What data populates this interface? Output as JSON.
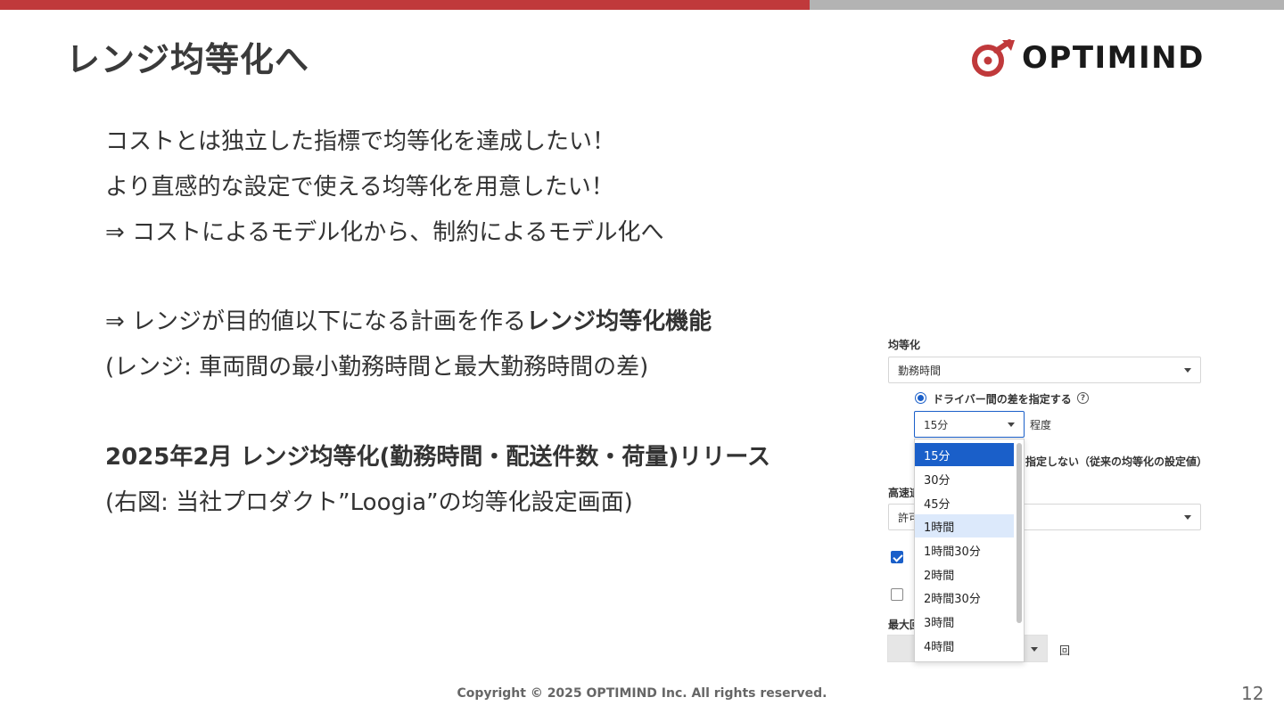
{
  "slide": {
    "title": "レンジ均等化へ",
    "logo_text": "OPTIMIND",
    "lines": [
      "コストとは独立した指標で均等化を達成したい！",
      "より直感的な設定で使える均等化を用意したい！",
      "⇒ コストによるモデル化から、制約によるモデル化へ"
    ],
    "feature_line_prefix": "⇒ レンジが目的値以下になる計画を作る",
    "feature_line_bold": "レンジ均等化機能",
    "range_def": "(レンジ: 車両間の最小勤務時間と最大勤務時間の差)",
    "release_line": "2025年2月 レンジ均等化(勤務時間・配送件数・荷量)リリース",
    "figure_caption": "(右図: 当社プロダクト”Loogia”の均等化設定画面)"
  },
  "settings_panel": {
    "section_label": "均等化",
    "metric_select_value": "勤務時間",
    "radio_option_label": "ドライバー間の差を指定する",
    "help_icon": "?",
    "diff_select_value": "15分",
    "diff_suffix": "程度",
    "other_option_fragment": "指定しない（従来の均等化の設定値）",
    "highway_label_fragment": "高速道",
    "highway_select_fragment": "許可",
    "max_label_fragment": "最大回",
    "count_suffix": "回",
    "dropdown_options": [
      "15分",
      "30分",
      "45分",
      "1時間",
      "1時間30分",
      "2時間",
      "2時間30分",
      "3時間",
      "4時間"
    ],
    "dropdown_selected": "15分",
    "dropdown_hovered": "1時間"
  },
  "footer": {
    "copyright": "Copyright © 2025 OPTIMIND Inc. All rights reserved.",
    "page_number": "12"
  },
  "colors": {
    "accent_red": "#c0393b",
    "accent_gray": "#b3b3b3",
    "select_blue": "#1a5fc9"
  }
}
